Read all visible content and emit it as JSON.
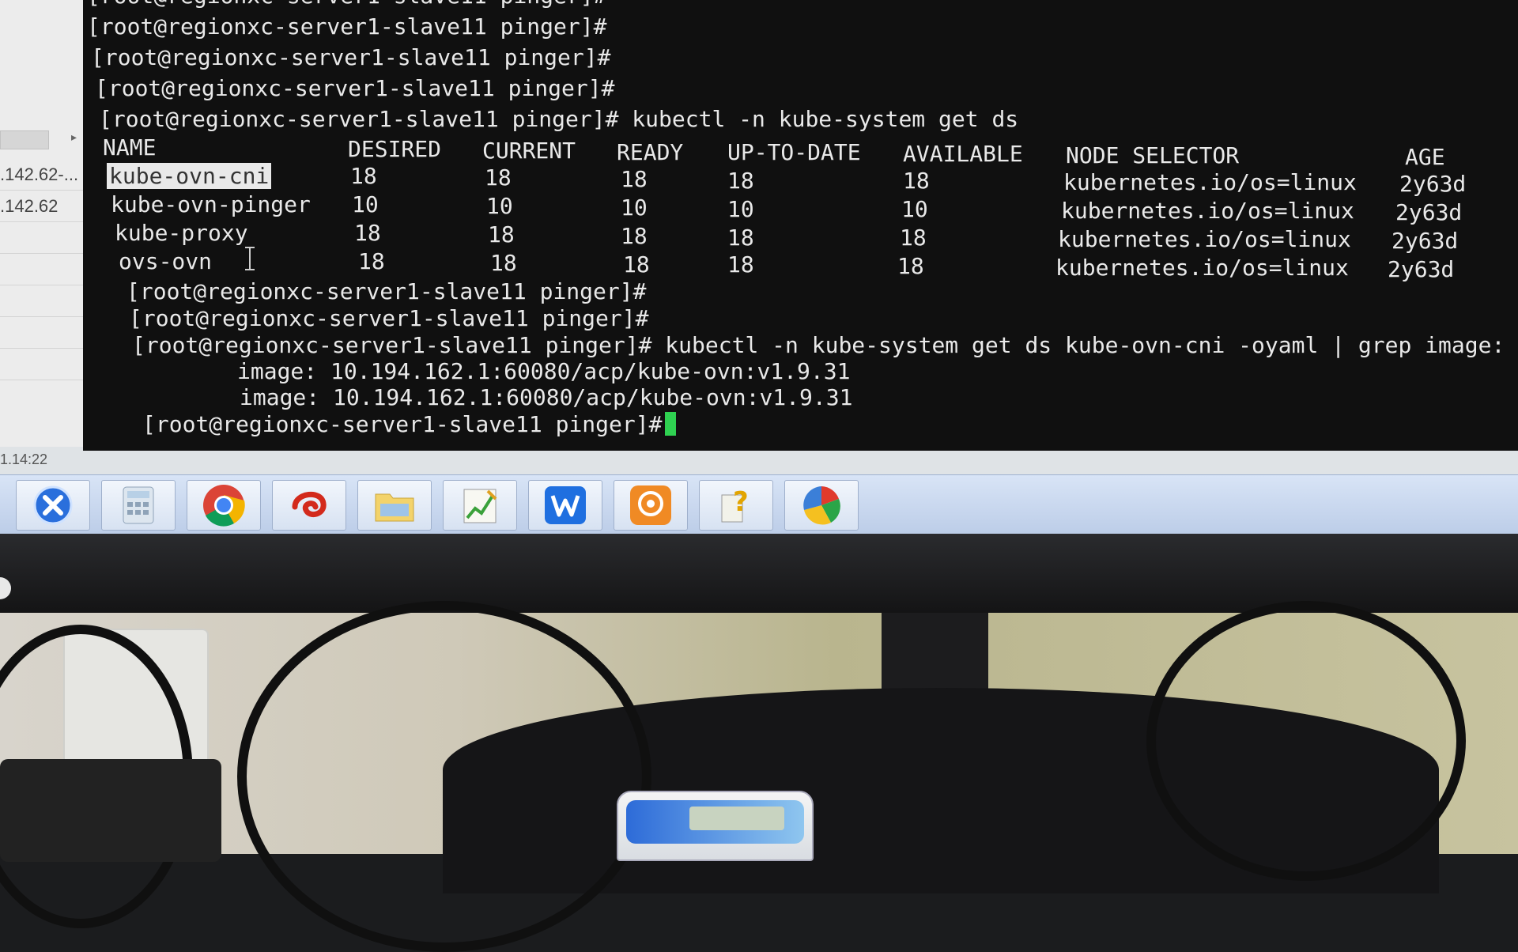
{
  "terminal": {
    "top_partial": "[root@regionxc-server1-slave11 pinger]#",
    "lines_before": [
      "[root@regionxc-server1-slave11 pinger]#",
      "[root@regionxc-server1-slave11 pinger]#",
      "[root@regionxc-server1-slave11 pinger]#"
    ],
    "cmd1": "[root@regionxc-server1-slave11 pinger]# kubectl -n kube-system get ds",
    "table": {
      "headers": [
        "NAME",
        "DESIRED",
        "CURRENT",
        "READY",
        "UP-TO-DATE",
        "AVAILABLE",
        "NODE SELECTOR",
        "AGE"
      ],
      "rows": [
        [
          "kube-ovn-cni",
          "18",
          "18",
          "18",
          "18",
          "18",
          "kubernetes.io/os=linux",
          "2y63d"
        ],
        [
          "kube-ovn-pinger",
          "10",
          "10",
          "10",
          "10",
          "10",
          "kubernetes.io/os=linux",
          "2y63d"
        ],
        [
          "kube-proxy",
          "18",
          "18",
          "18",
          "18",
          "18",
          "kubernetes.io/os=linux",
          "2y63d"
        ],
        [
          "ovs-ovn",
          "18",
          "18",
          "18",
          "18",
          "18",
          "kubernetes.io/os=linux",
          "2y63d"
        ]
      ]
    },
    "lines_after": [
      "[root@regionxc-server1-slave11 pinger]#",
      "[root@regionxc-server1-slave11 pinger]#"
    ],
    "cmd2": "[root@regionxc-server1-slave11 pinger]# kubectl -n kube-system get ds kube-ovn-cni -oyaml | grep image:",
    "image_lines": [
      "image: 10.194.162.1:60080/acp/kube-ovn:v1.9.31",
      "image: 10.194.162.1:60080/acp/kube-ovn:v1.9.31"
    ],
    "prompt_last": "[root@regionxc-server1-slave11 pinger]#"
  },
  "side_panel": {
    "items": [
      ".142.62-...",
      ".142.62"
    ]
  },
  "clock": "1.14:22",
  "taskbar": {
    "icons": [
      "app-x-icon",
      "calculator-icon",
      "chrome-icon",
      "red-swirl-app-icon",
      "file-explorer-icon",
      "chart-notepad-icon",
      "wps-writer-icon",
      "orange-app-icon",
      "help-icon",
      "pie-chart-app-icon"
    ]
  }
}
